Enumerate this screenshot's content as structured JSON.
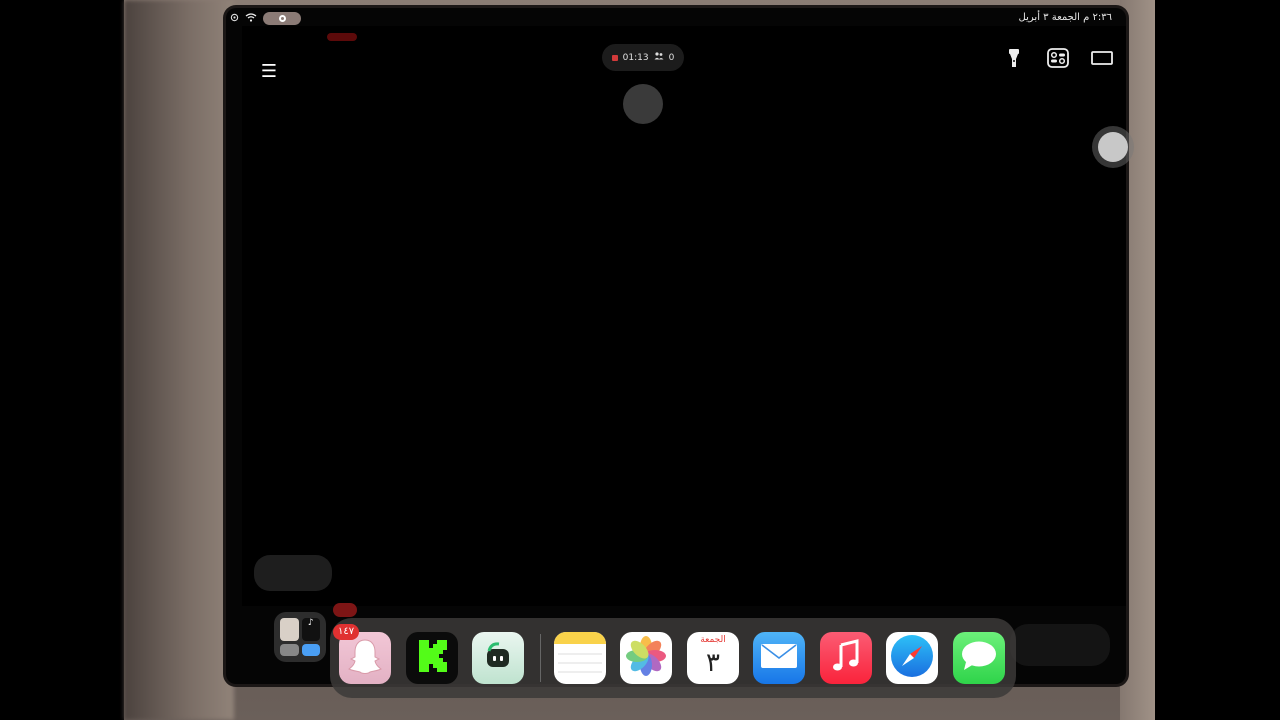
{
  "status_bar": {
    "datetime": "٢:٣٦ م   الجمعة ٣ أبريل"
  },
  "recording": {
    "timer": "01:13",
    "participants": "0"
  },
  "dock": {
    "badge": "١٤٧",
    "calendar_day": "الجمعة",
    "calendar_date": "٣",
    "apps": [
      "app-library",
      "snapchat",
      "kick",
      "app-green-robot",
      "notes",
      "photos",
      "calendar",
      "mail",
      "music",
      "safari",
      "messages"
    ]
  },
  "colors": {
    "accent_red": "#d23a3a",
    "dock_bg": "#3c3a38",
    "screen_bg": "#000000"
  }
}
